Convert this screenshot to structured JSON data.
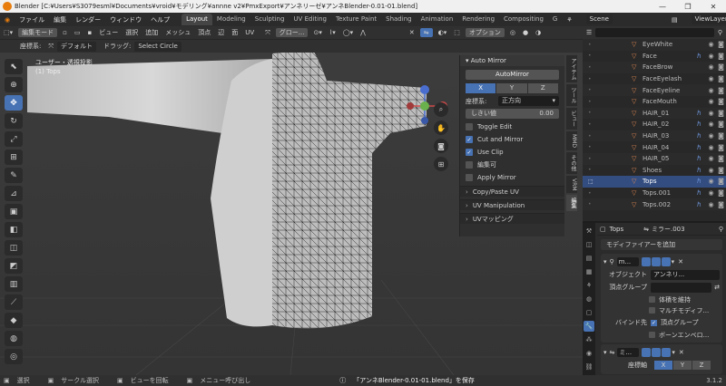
{
  "window": {
    "title": "Blender [C:¥Users¥S3079esml¥Documents¥vroid¥モデリング¥annne v2¥PmxExport¥アンネリーゼ¥アンネBlender-0.01-01.blend]"
  },
  "menu": [
    "ファイル",
    "編集",
    "レンダー",
    "ウィンドウ",
    "ヘルプ"
  ],
  "workspaces": [
    "Layout",
    "Modeling",
    "Sculpting",
    "UV Editing",
    "Texture Paint",
    "Shading",
    "Animation",
    "Rendering",
    "Compositing",
    "G"
  ],
  "scene": "Scene",
  "viewlayer": "ViewLayer",
  "vp_header": {
    "mode": "編集モード",
    "items": [
      "ビュー",
      "選択",
      "追加",
      "メッシュ",
      "頂点",
      "辺",
      "面",
      "UV"
    ],
    "global": "グロー...",
    "options": "オプション"
  },
  "vp_tool": {
    "coord_label": "座標系:",
    "coord": "デフォルト",
    "drag_label": "ドラッグ:",
    "drag": "Select Circle"
  },
  "vp_info": {
    "line1": "ユーザー・透視投影",
    "line2": "(1) Tops"
  },
  "npanel": {
    "title": "Auto Mirror",
    "button": "AutoMirror",
    "axes": [
      "X",
      "Y",
      "Z"
    ],
    "coord_label": "座標系:",
    "coord_value": "正方向",
    "threshold_label": "しきい値",
    "threshold_value": "0.00",
    "checks": [
      {
        "label": "Toggle Edit",
        "on": false
      },
      {
        "label": "Cut and Mirror",
        "on": true
      },
      {
        "label": "Use Clip",
        "on": true
      },
      {
        "label": "編集可",
        "on": false
      },
      {
        "label": "Apply Mirror",
        "on": false
      }
    ],
    "subpanels": [
      "Copy/Paste UV",
      "UV Manipulation",
      "UVマッピング"
    ]
  },
  "vtabs": [
    "アイテム",
    "ツール",
    "ビュー",
    "MMD",
    "その他",
    "VRM",
    "編集"
  ],
  "outliner": [
    {
      "name": "EyeWhite"
    },
    {
      "name": "Face"
    },
    {
      "name": "FaceBrow"
    },
    {
      "name": "FaceEyelash"
    },
    {
      "name": "FaceEyeline"
    },
    {
      "name": "FaceMouth"
    },
    {
      "name": "HAIR_01"
    },
    {
      "name": "HAIR_02"
    },
    {
      "name": "HAIR_03"
    },
    {
      "name": "HAIR_04"
    },
    {
      "name": "HAIR_05"
    },
    {
      "name": "Shoes"
    },
    {
      "name": "Tops",
      "selected": true
    },
    {
      "name": "Tops.001"
    },
    {
      "name": "Tops.002"
    }
  ],
  "properties": {
    "object": "Tops",
    "modifier_name": "ミラー.003",
    "add_modifier": "モディファイアーを追加",
    "mod1": {
      "name": "m...",
      "object_label": "オブジェクト",
      "object_value": "アンネリ...",
      "vgroup_label": "頂点グループ",
      "checks": [
        {
          "label": "体積を維持",
          "on": false
        },
        {
          "label": "マルチモディフ...",
          "on": false
        }
      ],
      "bind_label": "バインド先",
      "bind_checks": [
        {
          "label": "頂点グループ",
          "on": true
        },
        {
          "label": "ボーンエンベロ...",
          "on": false
        }
      ]
    },
    "mod2": {
      "name": "ミ...",
      "axis_label": "座標軸",
      "axes": [
        "X",
        "Y",
        "Z"
      ]
    }
  },
  "statusbar": {
    "select": "選択",
    "circle": "サークル選択",
    "rotate": "ビューを回転",
    "call": "メニュー呼び出し",
    "saved": "「アンネBlender-0.01-01.blend」を保存",
    "version": "3.1.2"
  }
}
